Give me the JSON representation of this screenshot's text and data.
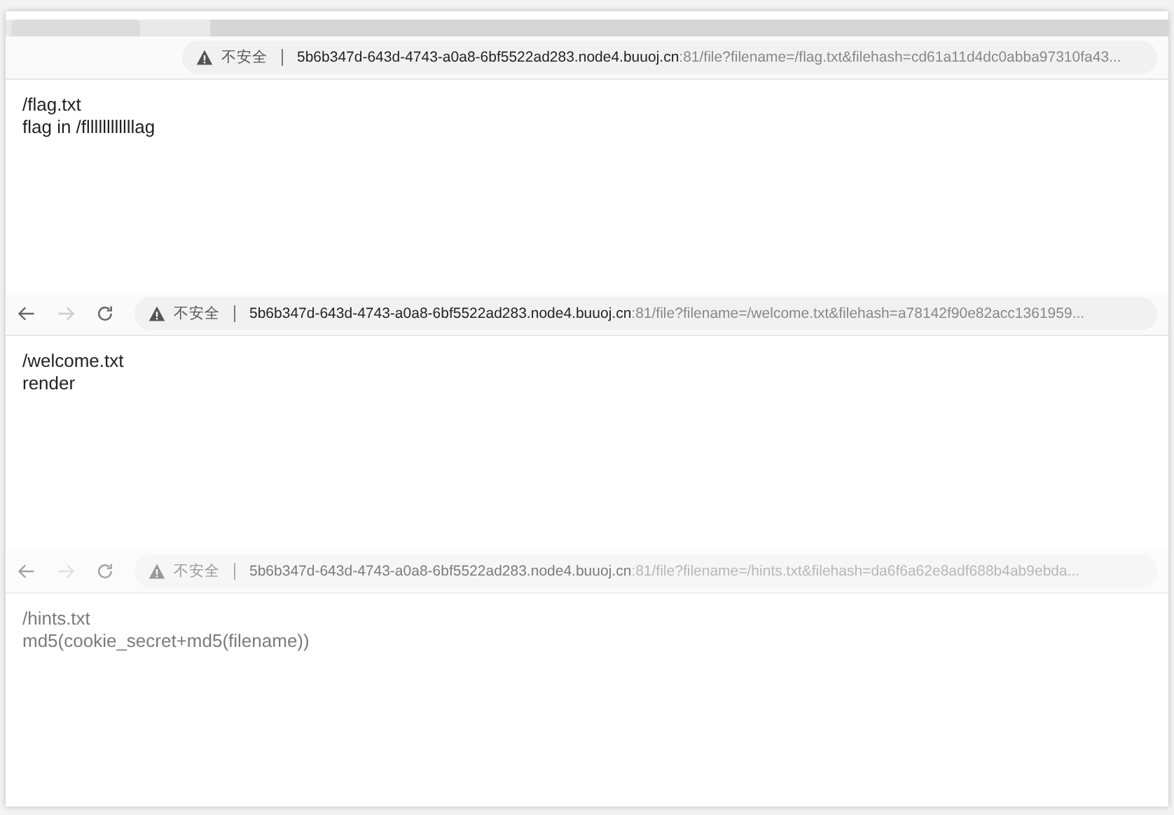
{
  "panels": [
    {
      "nav": false,
      "faded": false,
      "security": "不安全",
      "host": "5b6b347d-643d-4743-a0a8-6bf5522ad283.node4.buuoj.cn",
      "path": ":81/file?filename=/flag.txt&filehash=cd61a11d4dc0abba97310fa43...",
      "lines": [
        "/flag.txt",
        "flag in /fllllllllllllag"
      ]
    },
    {
      "nav": true,
      "faded": false,
      "security": "不安全",
      "host": "5b6b347d-643d-4743-a0a8-6bf5522ad283.node4.buuoj.cn",
      "path": ":81/file?filename=/welcome.txt&filehash=a78142f90e82acc1361959...",
      "lines": [
        "/welcome.txt",
        "render"
      ]
    },
    {
      "nav": true,
      "faded": true,
      "security": "不安全",
      "host": "5b6b347d-643d-4743-a0a8-6bf5522ad283.node4.buuoj.cn",
      "path": ":81/file?filename=/hints.txt&filehash=da6f6a62e8adf688b4ab9ebda...",
      "lines": [
        "/hints.txt",
        "md5(cookie_secret+md5(filename))"
      ]
    }
  ]
}
